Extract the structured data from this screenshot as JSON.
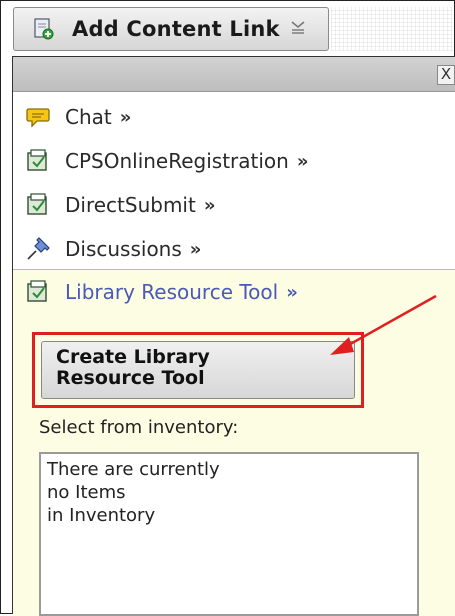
{
  "toolbar": {
    "add_content_link_label": "Add Content Link",
    "caret_icon": "chevron-down-icon"
  },
  "panel": {
    "close_label": "X",
    "items": [
      {
        "label": "Chat",
        "arrow": "»",
        "icon": "chat-bubble-icon"
      },
      {
        "label": "CPSOnlineRegistration",
        "arrow": "»",
        "icon": "tool-icon"
      },
      {
        "label": "DirectSubmit",
        "arrow": "»",
        "icon": "tool-icon"
      },
      {
        "label": "Discussions",
        "arrow": "»",
        "icon": "pin-icon"
      }
    ],
    "library": {
      "label": "Library Resource Tool",
      "arrow": "»",
      "icon": "tool-icon",
      "create_button_line1": "Create Library",
      "create_button_line2": "Resource Tool",
      "inventory_label": "Select from inventory:",
      "inventory_lines": [
        "There are currently",
        "no Items",
        "in Inventory"
      ]
    }
  },
  "colors": {
    "highlight": "#e02020",
    "library_link": "#4a59b8",
    "library_bg": "#fdfde3"
  }
}
